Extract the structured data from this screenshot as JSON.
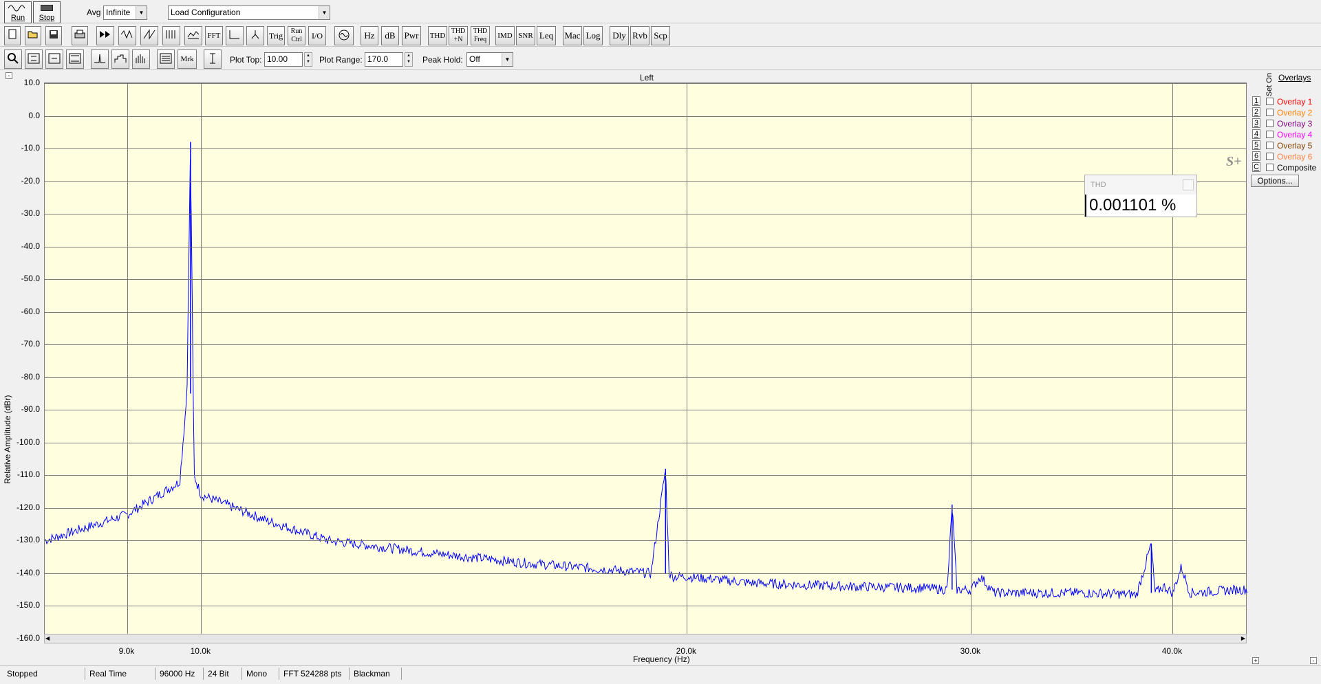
{
  "toolbar_top": {
    "run_label": "Run",
    "stop_label": "Stop",
    "avg_label": "Avg",
    "avg_value": "Infinite",
    "config_value": "Load Configuration"
  },
  "toolbar_mid": {
    "buttons": [
      "FFT",
      "Trig",
      "Run Ctrl",
      "I/O",
      "Hz",
      "dB",
      "Pwr",
      "THD",
      "THD +N",
      "THD Freq",
      "IMD",
      "SNR",
      "Leq",
      "Mac",
      "Log",
      "Dly",
      "Rvb",
      "Scp"
    ]
  },
  "toolbar_bottom": {
    "mrk_label": "Mrk",
    "plot_top_label": "Plot Top:",
    "plot_top_value": "10.00",
    "plot_range_label": "Plot Range:",
    "plot_range_value": "170.0",
    "peak_hold_label": "Peak Hold:",
    "peak_hold_value": "Off"
  },
  "plot": {
    "title": "Left",
    "ylabel": "Relative Amplitude (dBr)",
    "xlabel": "Frequency (Hz)",
    "yticks": [
      "10.0",
      "0.0",
      "-10.0",
      "-20.0",
      "-30.0",
      "-40.0",
      "-50.0",
      "-60.0",
      "-70.0",
      "-80.0",
      "-90.0",
      "-100.0",
      "-110.0",
      "-120.0",
      "-130.0",
      "-140.0",
      "-150.0",
      "-160.0"
    ],
    "xticks": [
      "9.0k",
      "10.0k",
      "20.0k",
      "30.0k",
      "40.0k"
    ],
    "trace_color": "#0000ff",
    "background": "#ffffe0"
  },
  "chart_data": {
    "type": "line",
    "xlabel": "Frequency (Hz)",
    "ylabel": "Relative Amplitude (dBr)",
    "title": "Left",
    "ylim": [
      -160,
      10
    ],
    "xscale": "log",
    "series": [
      {
        "x": [
          8000,
          9000,
          9700,
          9800,
          9850,
          9900,
          10000,
          11000,
          12000,
          14000,
          16000,
          18000,
          19000,
          19400,
          19500,
          19600,
          20000,
          22000,
          25000,
          28000,
          29000,
          29200,
          29400,
          30000,
          30400,
          31000,
          35000,
          38000,
          38800,
          39000,
          39500,
          40000,
          40500,
          41000,
          44000
        ],
        "y": [
          -130,
          -122,
          -112,
          -85,
          -8,
          -110,
          -116,
          -124,
          -130,
          -134,
          -137,
          -139,
          -140,
          -108,
          -140,
          -141,
          -141,
          -143,
          -144,
          -144.5,
          -145,
          -119,
          -145,
          -145,
          -141,
          -146,
          -146,
          -146.5,
          -131,
          -146,
          -144,
          -146,
          -138,
          -146,
          -145
        ]
      }
    ]
  },
  "thd": {
    "header": "THD",
    "value": "0.001101 %"
  },
  "overlays": {
    "title": "Overlays",
    "set_label": "Set",
    "on_label": "On",
    "items": [
      {
        "num": "1",
        "label": "Overlay 1",
        "color": "#ff0000"
      },
      {
        "num": "2",
        "label": "Overlay 2",
        "color": "#ff8000"
      },
      {
        "num": "3",
        "label": "Overlay 3",
        "color": "#800080"
      },
      {
        "num": "4",
        "label": "Overlay 4",
        "color": "#ff00ff"
      },
      {
        "num": "5",
        "label": "Overlay 5",
        "color": "#804000"
      },
      {
        "num": "6",
        "label": "Overlay 6",
        "color": "#ff8040"
      },
      {
        "num": "C",
        "label": "Composite",
        "color": "#000000"
      }
    ],
    "options_label": "Options..."
  },
  "status": {
    "state": "Stopped",
    "mode": "Real Time",
    "rate": "96000 Hz",
    "bits": "24 Bit",
    "channels": "Mono",
    "fft": "FFT 524288 pts",
    "window": "Blackman"
  }
}
